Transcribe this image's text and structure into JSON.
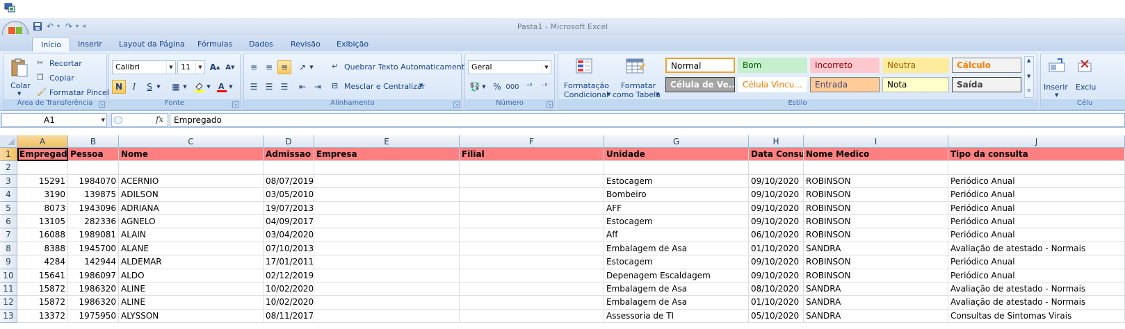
{
  "window": {
    "title": "Pasta1 - Microsoft Excel"
  },
  "quick_access": [
    "save-icon",
    "undo-icon",
    "redo-icon",
    "customize-icon"
  ],
  "tabs": [
    "Início",
    "Inserir",
    "Layout da Página",
    "Fórmulas",
    "Dados",
    "Revisão",
    "Exibição"
  ],
  "ribbon": {
    "clipboard": {
      "paste": "Colar",
      "cut": "Recortar",
      "copy": "Copiar",
      "format_painter": "Formatar Pincel",
      "label": "Área de Transferência"
    },
    "font": {
      "name": "Calibri",
      "size": "11",
      "label": "Fonte"
    },
    "alignment": {
      "wrap": "Quebrar Texto Automaticamente",
      "merge": "Mesclar e Centralizar",
      "label": "Alinhamento"
    },
    "number": {
      "format": "Geral",
      "percent": "%",
      "thousands": "000",
      "label": "Número"
    },
    "styles": {
      "conditional": [
        "Formatação",
        "Condicional"
      ],
      "as_table": [
        "Formatar",
        "como Tabela"
      ],
      "cells": [
        {
          "text": "Normal",
          "bg": "#ffffff",
          "fg": "#000000",
          "border": "#f0a030",
          "bold": false
        },
        {
          "text": "Bom",
          "bg": "#c6efce",
          "fg": "#006100",
          "border": "#c6efce",
          "bold": false
        },
        {
          "text": "Incorreto",
          "bg": "#ffc7ce",
          "fg": "#9c0006",
          "border": "#ffc7ce",
          "bold": false
        },
        {
          "text": "Neutra",
          "bg": "#ffeb9c",
          "fg": "#9c6500",
          "border": "#ffeb9c",
          "bold": false
        },
        {
          "text": "Cálculo",
          "bg": "#f2f2f2",
          "fg": "#fa7d00",
          "border": "#7f7f7f",
          "bold": true
        },
        {
          "text": "Célula de Ve...",
          "bg": "#a5a5a5",
          "fg": "#ffffff",
          "border": "#3f3f3f",
          "bold": true
        },
        {
          "text": "Célula Vincu...",
          "bg": "#ffffff",
          "fg": "#fa7d00",
          "border": "#ffffff",
          "bold": false
        },
        {
          "text": "Entrada",
          "bg": "#ffcc99",
          "fg": "#3f3f76",
          "border": "#7f7f7f",
          "bold": false
        },
        {
          "text": "Nota",
          "bg": "#ffffcc",
          "fg": "#000000",
          "border": "#b2b2b2",
          "bold": false
        },
        {
          "text": "Saída",
          "bg": "#f2f2f2",
          "fg": "#3f3f3f",
          "border": "#3f3f3f",
          "bold": true
        }
      ],
      "label": "Estilo"
    },
    "cells": {
      "insert": "Inserir",
      "delete": "Exclu",
      "label": "Célu"
    }
  },
  "formula_bar": {
    "name_box": "A1",
    "fx": "fx",
    "content": "Empregado"
  },
  "grid": {
    "header_color": "#ff8080",
    "columns": [
      "A",
      "B",
      "C",
      "D",
      "E",
      "F",
      "G",
      "H",
      "I",
      "J"
    ],
    "rows": [
      [
        "Empregado",
        "Pessoa",
        "Nome",
        "Admissao",
        "Empresa",
        "Filial",
        "Unidade",
        "Data Consult",
        "Nome Medico",
        "Tipo da consulta"
      ],
      [
        "",
        "",
        "",
        "",
        "",
        "",
        "",
        "",
        "",
        ""
      ],
      [
        "15291",
        "1984070",
        "ACERNIO",
        "08/07/2019",
        "",
        "",
        "Estocagem",
        "09/10/2020",
        "ROBINSON",
        "Periódico Anual"
      ],
      [
        "3190",
        "139875",
        "ADILSON",
        "03/05/2010",
        "",
        "",
        "Bombeiro",
        "09/10/2020",
        "ROBINSON",
        "Periódico Anual"
      ],
      [
        "8073",
        "1943096",
        "ADRIANA",
        "19/07/2013",
        "",
        "",
        "AFF",
        "09/10/2020",
        "ROBINSON",
        "Periódico Anual"
      ],
      [
        "13105",
        "282336",
        "AGNELO",
        "04/09/2017",
        "",
        "",
        "Estocagem",
        "09/10/2020",
        "ROBINSON",
        "Periódico Anual"
      ],
      [
        "16088",
        "1989081",
        "ALAIN",
        "03/04/2020",
        "",
        "",
        "Aff",
        "06/10/2020",
        "ROBINSON",
        "Periódico Anual"
      ],
      [
        "8388",
        "1945700",
        "ALANE",
        "07/10/2013",
        "",
        "",
        "Embalagem de Asa",
        "01/10/2020",
        "SANDRA",
        "Avaliação de atestado - Normais"
      ],
      [
        "4284",
        "142944",
        "ALDEMAR",
        "17/01/2011",
        "",
        "",
        "Estocagem",
        "09/10/2020",
        "ROBINSON",
        "Periódico Anual"
      ],
      [
        "15641",
        "1986097",
        "ALDO",
        "02/12/2019",
        "",
        "",
        "Depenagem Escaldagem",
        "09/10/2020",
        "ROBINSON",
        "Periódico Anual"
      ],
      [
        "15872",
        "1986320",
        "ALINE",
        "10/02/2020",
        "",
        "",
        "Embalagem de Asa",
        "08/10/2020",
        "SANDRA",
        "Avaliação de atestado - Normais"
      ],
      [
        "15872",
        "1986320",
        "ALINE",
        "10/02/2020",
        "",
        "",
        "Embalagem de Asa",
        "01/10/2020",
        "SANDRA",
        "Avaliação de atestado - Normais"
      ],
      [
        "13372",
        "1975950",
        "ALYSSON",
        "08/11/2017",
        "",
        "",
        "Assessoria de TI",
        "05/10/2020",
        "SANDRA",
        "Consultas de Sintomas Virais"
      ]
    ]
  }
}
